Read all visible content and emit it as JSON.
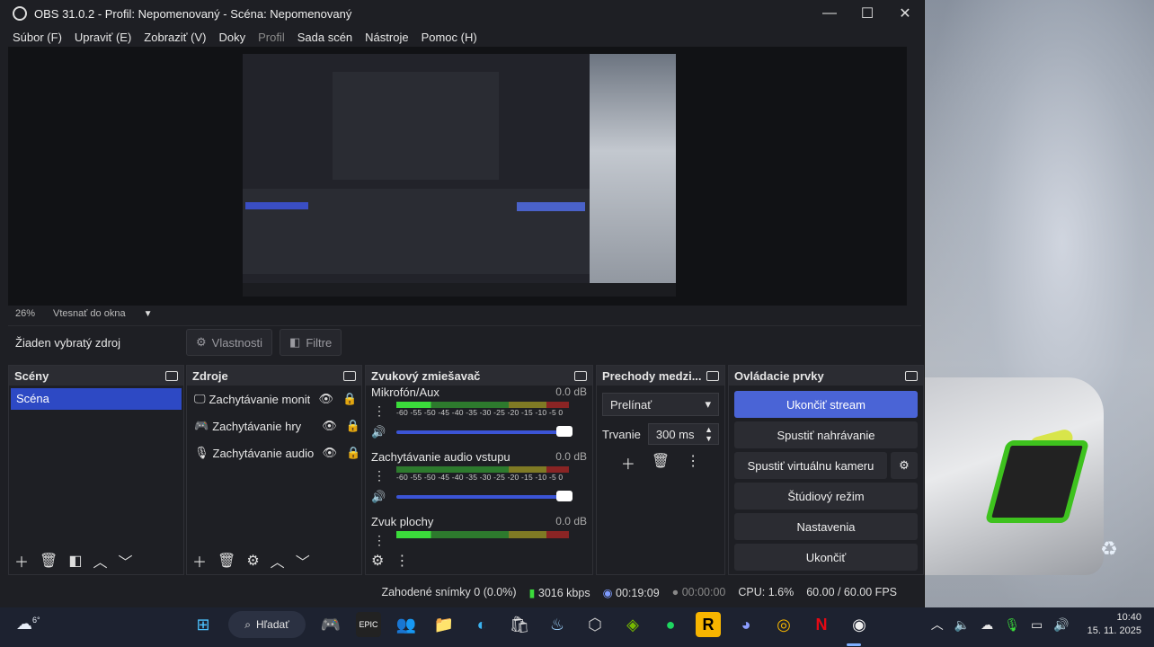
{
  "window": {
    "title": "OBS 31.0.2 - Profil: Nepomenovaný - Scéna: Nepomenovaný",
    "minimize": "—",
    "maximize": "☐",
    "close": "✕"
  },
  "menu": {
    "file": "Súbor (F)",
    "edit": "Upraviť (E)",
    "view": "Zobraziť (V)",
    "docks": "Doky",
    "profile": "Profil",
    "scene_collection": "Sada scén",
    "tools": "Nástroje",
    "help": "Pomoc (H)"
  },
  "preview": {
    "zoom": "26%",
    "fit_mode": "Vtesnať do okna"
  },
  "source_bar": {
    "no_source": "Žiaden vybratý zdroj",
    "properties": "Vlastnosti",
    "filters": "Filtre"
  },
  "scenes": {
    "title": "Scény",
    "items": [
      "Scéna"
    ]
  },
  "sources": {
    "title": "Zdroje",
    "items": [
      {
        "label": "Zachytávanie monit",
        "icon": "monitor-icon"
      },
      {
        "label": "Zachytávanie hry",
        "icon": "gamepad-icon"
      },
      {
        "label": "Zachytávanie audio",
        "icon": "microphone-icon"
      }
    ]
  },
  "mixer": {
    "title": "Zvukový zmiešavač",
    "scale": "-60 -55 -50 -45 -40 -35 -30 -25 -20 -15 -10 -5 0",
    "channels": [
      {
        "name": "Mikrofón/Aux",
        "db": "0.0 dB",
        "volume": 1.0
      },
      {
        "name": "Zachytávanie audio vstupu",
        "db": "0.0 dB",
        "volume": 1.0
      },
      {
        "name": "Zvuk plochy",
        "db": "0.0 dB",
        "volume": 1.0
      }
    ]
  },
  "transitions": {
    "title": "Prechody medzi...",
    "selected": "Prelínať",
    "duration_label": "Trvanie",
    "duration_value": "300 ms"
  },
  "controls": {
    "title": "Ovládacie prvky",
    "stop_stream": "Ukončiť stream",
    "start_recording": "Spustiť nahrávanie",
    "start_virtual_cam": "Spustiť virtuálnu kameru",
    "studio_mode": "Štúdiový režim",
    "settings": "Nastavenia",
    "exit": "Ukončiť"
  },
  "status": {
    "dropped": "Zahodené snímky 0 (0.0%)",
    "bitrate": "3016 kbps",
    "stream_time": "00:19:09",
    "rec_time": "00:00:00",
    "cpu": "CPU: 1.6%",
    "fps": "60.00 / 60.00 FPS"
  },
  "taskbar": {
    "temperature": "6°",
    "search": "Hľadať",
    "time": "10:40",
    "date": "15. 11. 2025"
  },
  "colors": {
    "accent": "#4a64d6",
    "scene_selected": "#2d49c4",
    "meter_green": "#3bdc3b",
    "meter_yellow": "#7f7a24",
    "meter_red": "#8a2424"
  }
}
